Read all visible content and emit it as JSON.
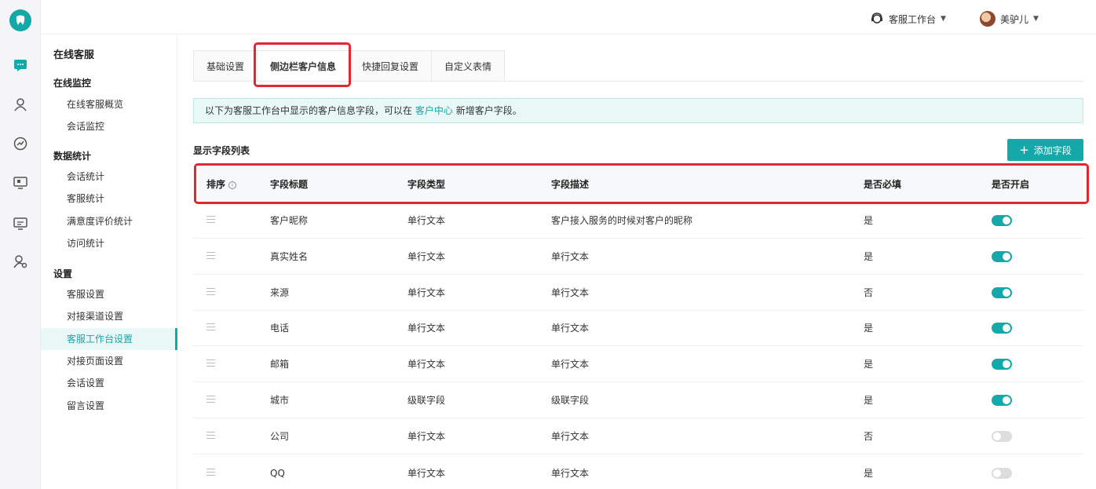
{
  "topbar": {
    "workspace_label": "客服工作台",
    "user_name": "美驴儿"
  },
  "rail": {
    "logo_icon": "tooth-icon",
    "icons": [
      "chat-icon",
      "user-service-icon",
      "chart-icon",
      "monitor-icon",
      "screen-icon",
      "user-settings-icon"
    ]
  },
  "menu": {
    "title": "在线客服",
    "groups": [
      {
        "label": "在线监控",
        "items": [
          "在线客服概览",
          "会话监控"
        ]
      },
      {
        "label": "数据统计",
        "items": [
          "会话统计",
          "客服统计",
          "满意度评价统计",
          "访问统计"
        ]
      },
      {
        "label": "设置",
        "items": [
          "客服设置",
          "对接渠道设置",
          "客服工作台设置",
          "对接页面设置",
          "会话设置",
          "留言设置"
        ]
      }
    ],
    "active_item": "客服工作台设置"
  },
  "tabs": [
    "基础设置",
    "侧边栏客户信息",
    "快捷回复设置",
    "自定义表情"
  ],
  "active_tab": "侧边栏客户信息",
  "notice": {
    "prefix": "以下为客服工作台中显示的客户信息字段，可以在",
    "link": "客户中心",
    "suffix": "新增客户字段。"
  },
  "section_title": "显示字段列表",
  "add_button_label": "添加字段",
  "table": {
    "headers": [
      "排序",
      "字段标题",
      "字段类型",
      "字段描述",
      "是否必填",
      "是否开启"
    ],
    "rows": [
      {
        "title": "客户昵称",
        "type": "单行文本",
        "desc": "客户接入服务的时候对客户的昵称",
        "required": "是",
        "enabled": true
      },
      {
        "title": "真实姓名",
        "type": "单行文本",
        "desc": "单行文本",
        "required": "是",
        "enabled": true
      },
      {
        "title": "来源",
        "type": "单行文本",
        "desc": "单行文本",
        "required": "否",
        "enabled": true
      },
      {
        "title": "电话",
        "type": "单行文本",
        "desc": "单行文本",
        "required": "是",
        "enabled": true
      },
      {
        "title": "邮箱",
        "type": "单行文本",
        "desc": "单行文本",
        "required": "是",
        "enabled": true
      },
      {
        "title": "城市",
        "type": "级联字段",
        "desc": "级联字段",
        "required": "是",
        "enabled": true
      },
      {
        "title": "公司",
        "type": "单行文本",
        "desc": "单行文本",
        "required": "否",
        "enabled": false
      },
      {
        "title": "QQ",
        "type": "单行文本",
        "desc": "单行文本",
        "required": "是",
        "enabled": false
      }
    ]
  },
  "colors": {
    "accent": "#14a8a8",
    "highlight": "#e3262f"
  }
}
